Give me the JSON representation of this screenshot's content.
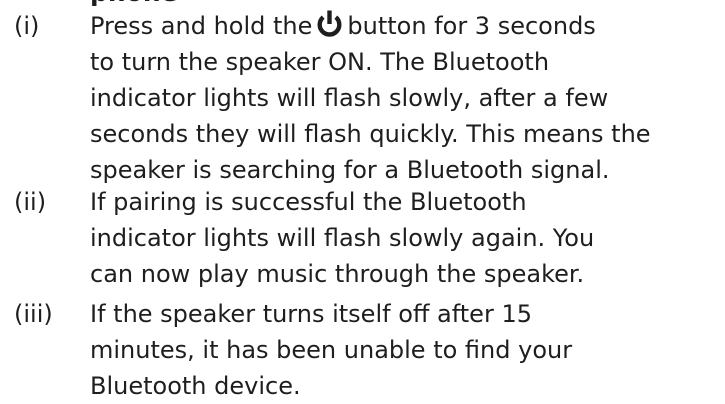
{
  "heading_partial": "phone",
  "colors": {
    "text": "#1e1e1e",
    "background": "#ffffff"
  },
  "items": [
    {
      "marker": "(i)",
      "line1_before_icon": "Press and hold the",
      "icon": "power-icon",
      "line1_after_icon": "button for 3 seconds",
      "lines": [
        "to turn the speaker ON.  The Bluetooth",
        "indicator lights will  flash slowly, after a few",
        "seconds they will flash quickly.  This means the",
        "speaker is searching for a Bluetooth signal."
      ]
    },
    {
      "marker": "(ii)",
      "lines": [
        "If pairing is successful the Bluetooth",
        "indicator lights will flash slowly again. You",
        "can now play music through the speaker."
      ]
    },
    {
      "marker": "(iii)",
      "lines": [
        "If the speaker turns itself off after 15",
        "minutes, it has been unable to find your",
        "Bluetooth device."
      ]
    }
  ]
}
